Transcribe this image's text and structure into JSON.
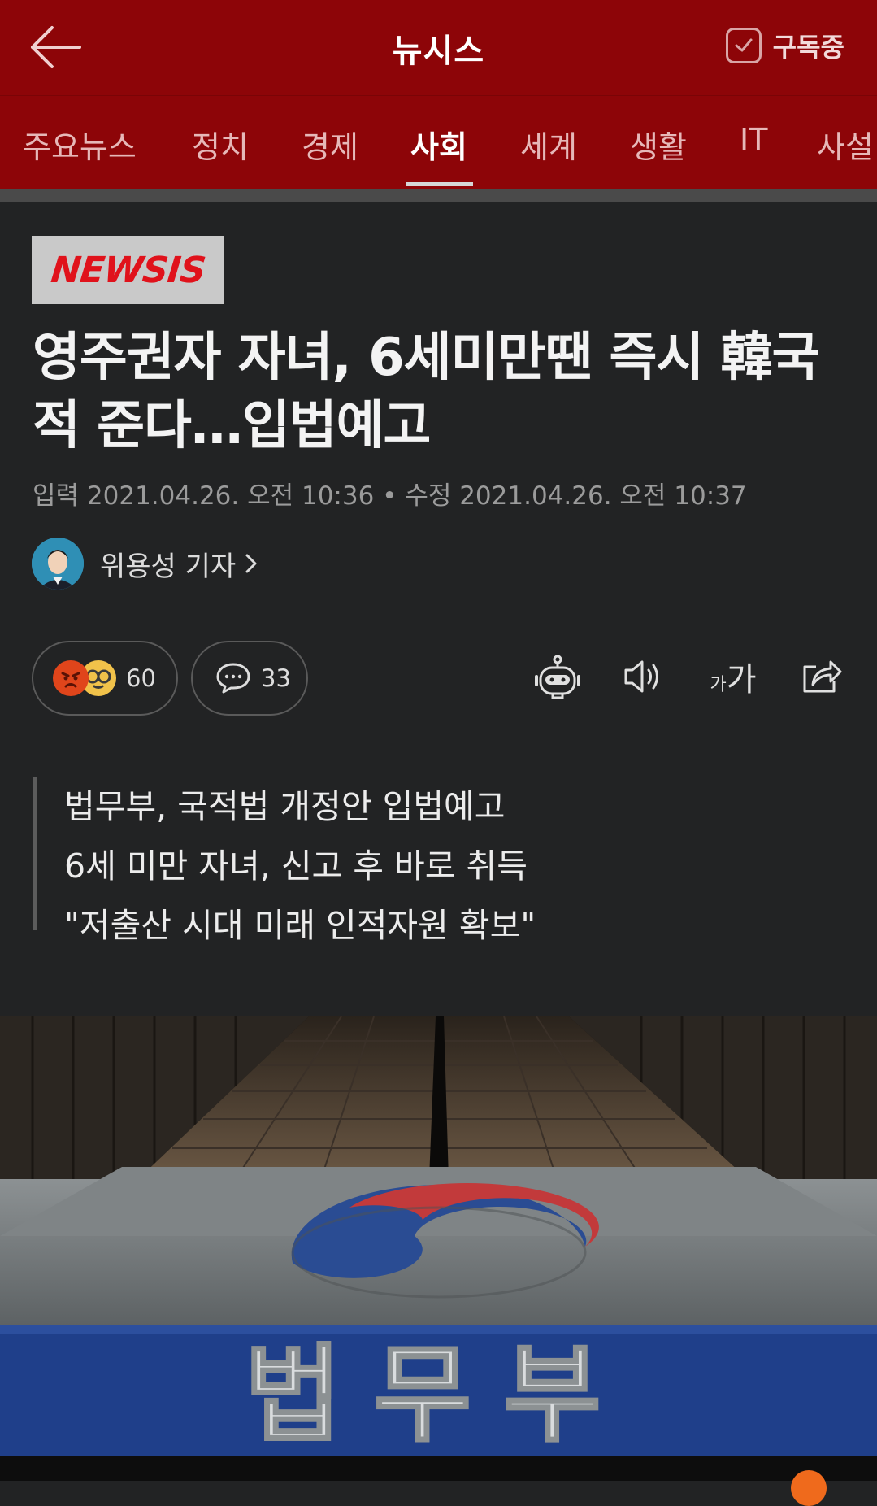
{
  "header": {
    "title": "뉴시스",
    "subscribe_label": "구독중"
  },
  "tabs": [
    {
      "label": "주요뉴스",
      "active": false
    },
    {
      "label": "정치",
      "active": false
    },
    {
      "label": "경제",
      "active": false
    },
    {
      "label": "사회",
      "active": true
    },
    {
      "label": "세계",
      "active": false
    },
    {
      "label": "생활",
      "active": false
    },
    {
      "label": "IT",
      "active": false
    },
    {
      "label": "사설",
      "active": false
    }
  ],
  "article": {
    "publisher_logo": "NEWSIS",
    "headline": "영주권자 자녀, 6세미만땐 즉시 韓국적 준다…입법예고",
    "meta": "입력 2021.04.26. 오전 10:36 • 수정 2021.04.26. 오전 10:37",
    "reporter": "위용성 기자",
    "reaction_count": "60",
    "comment_count": "33",
    "font_size_label": "가가",
    "summary": [
      "법무부, 국적법 개정안 입법예고",
      "6세 미만 자녀, 신고 후 바로 취득",
      "\"저출산 시대 미래 인적자원 확보\""
    ],
    "photo_sign_text": "법무부"
  },
  "colors": {
    "header_bg": "#8d0508",
    "page_bg": "#222324",
    "logo_red": "#e0121b",
    "sign_blue": "#1f3f8a"
  }
}
